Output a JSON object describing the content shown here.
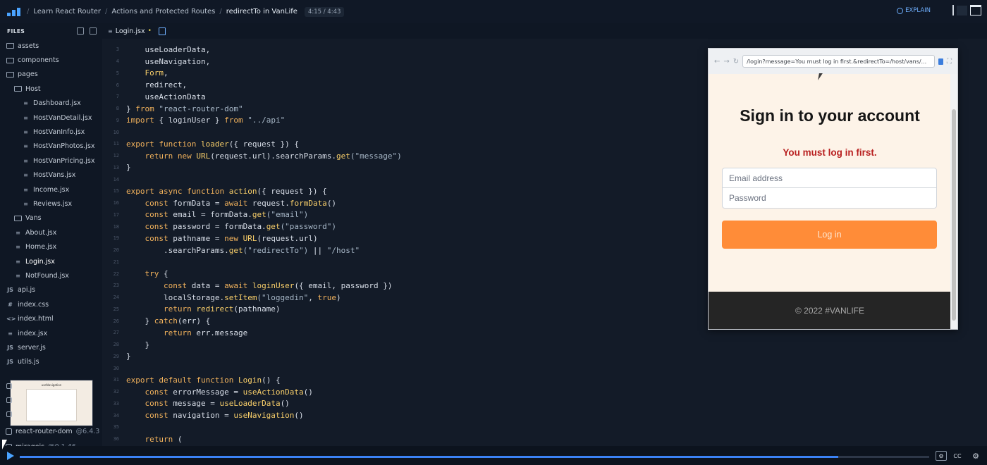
{
  "topbar": {
    "breadcrumbs": [
      "Learn React Router",
      "Actions and Protected Routes",
      "redirectTo in VanLife"
    ],
    "time": "4:15 / 4:43",
    "explain_label": "EXPLAIN"
  },
  "sidebar": {
    "header": "FILES",
    "items": [
      {
        "label": "assets",
        "type": "folder",
        "level": 0
      },
      {
        "label": "components",
        "type": "folder",
        "level": 0
      },
      {
        "label": "pages",
        "type": "folder",
        "level": 0
      },
      {
        "label": "Host",
        "type": "folder",
        "level": 1
      },
      {
        "label": "Dashboard.jsx",
        "type": "jsx",
        "level": 2
      },
      {
        "label": "HostVanDetail.jsx",
        "type": "jsx",
        "level": 2
      },
      {
        "label": "HostVanInfo.jsx",
        "type": "jsx",
        "level": 2
      },
      {
        "label": "HostVanPhotos.jsx",
        "type": "jsx",
        "level": 2
      },
      {
        "label": "HostVanPricing.jsx",
        "type": "jsx",
        "level": 2
      },
      {
        "label": "HostVans.jsx",
        "type": "jsx",
        "level": 2
      },
      {
        "label": "Income.jsx",
        "type": "jsx",
        "level": 2
      },
      {
        "label": "Reviews.jsx",
        "type": "jsx",
        "level": 2
      },
      {
        "label": "Vans",
        "type": "folder",
        "level": 1
      },
      {
        "label": "About.jsx",
        "type": "jsx",
        "level": 1
      },
      {
        "label": "Home.jsx",
        "type": "jsx",
        "level": 1
      },
      {
        "label": "Login.jsx",
        "type": "jsx",
        "level": 1,
        "current": true
      },
      {
        "label": "NotFound.jsx",
        "type": "jsx",
        "level": 1
      },
      {
        "label": "api.js",
        "type": "js",
        "level": 0
      },
      {
        "label": "index.css",
        "type": "css",
        "level": 0
      },
      {
        "label": "index.html",
        "type": "html",
        "level": 0
      },
      {
        "label": "index.jsx",
        "type": "jsx",
        "level": 0
      },
      {
        "label": "server.js",
        "type": "js",
        "level": 0
      },
      {
        "label": "utils.js",
        "type": "js",
        "level": 0
      }
    ],
    "thumbnail_title": "useNavigation",
    "packages": [
      {
        "name": "react-router-dom",
        "version": "@6.4.3"
      },
      {
        "name": "miragejs",
        "version": "@0.1.46"
      }
    ]
  },
  "editor": {
    "tab_label": "Login.jsx",
    "tab_modified": "•",
    "lines": [
      {
        "n": "3",
        "tokens": [
          [
            "plain",
            "    useLoaderData,"
          ]
        ]
      },
      {
        "n": "4",
        "tokens": [
          [
            "plain",
            "    useNavigation,"
          ]
        ]
      },
      {
        "n": "5",
        "tokens": [
          [
            "fn",
            "    Form"
          ],
          [
            "plain",
            ","
          ]
        ]
      },
      {
        "n": "6",
        "tokens": [
          [
            "plain",
            "    redirect,"
          ]
        ]
      },
      {
        "n": "7",
        "tokens": [
          [
            "plain",
            "    useActionData"
          ]
        ]
      },
      {
        "n": "8",
        "tokens": [
          [
            "plain",
            "} "
          ],
          [
            "kw",
            "from"
          ],
          [
            "str",
            " \"react-router-dom\""
          ]
        ]
      },
      {
        "n": "9",
        "tokens": [
          [
            "kw",
            "import"
          ],
          [
            "plain",
            " { loginUser } "
          ],
          [
            "kw",
            "from"
          ],
          [
            "str",
            " \"../api\""
          ]
        ]
      },
      {
        "n": "10",
        "tokens": [
          [
            "plain",
            ""
          ]
        ]
      },
      {
        "n": "11",
        "tokens": [
          [
            "kw",
            "export function"
          ],
          [
            "fn",
            " loader"
          ],
          [
            "plain",
            "({ request }) {"
          ]
        ]
      },
      {
        "n": "12",
        "tokens": [
          [
            "kw",
            "    return new"
          ],
          [
            "fn",
            " URL"
          ],
          [
            "plain",
            "(request.url).searchParams."
          ],
          [
            "fn",
            "get"
          ],
          [
            "str",
            "(\"message\")"
          ]
        ]
      },
      {
        "n": "13",
        "tokens": [
          [
            "plain",
            "}"
          ]
        ]
      },
      {
        "n": "14",
        "tokens": [
          [
            "plain",
            ""
          ]
        ]
      },
      {
        "n": "15",
        "tokens": [
          [
            "kw",
            "export async function"
          ],
          [
            "fn",
            " action"
          ],
          [
            "plain",
            "({ request }) {"
          ]
        ]
      },
      {
        "n": "16",
        "tokens": [
          [
            "kw",
            "    const"
          ],
          [
            "plain",
            " formData = "
          ],
          [
            "kw",
            "await"
          ],
          [
            "plain",
            " request."
          ],
          [
            "fn",
            "formData"
          ],
          [
            "plain",
            "()"
          ]
        ]
      },
      {
        "n": "17",
        "tokens": [
          [
            "kw",
            "    const"
          ],
          [
            "plain",
            " email = formData."
          ],
          [
            "fn",
            "get"
          ],
          [
            "str",
            "(\"email\")"
          ]
        ]
      },
      {
        "n": "18",
        "tokens": [
          [
            "kw",
            "    const"
          ],
          [
            "plain",
            " password = formData."
          ],
          [
            "fn",
            "get"
          ],
          [
            "str",
            "(\"password\")"
          ]
        ]
      },
      {
        "n": "19",
        "tokens": [
          [
            "kw",
            "    const"
          ],
          [
            "plain",
            " pathname = "
          ],
          [
            "kw",
            "new"
          ],
          [
            "fn",
            " URL"
          ],
          [
            "plain",
            "(request.url)"
          ]
        ]
      },
      {
        "n": "20",
        "tokens": [
          [
            "plain",
            "        .searchParams."
          ],
          [
            "fn",
            "get"
          ],
          [
            "str",
            "(\"redirectTo\")"
          ],
          [
            "plain",
            " || "
          ],
          [
            "str",
            "\"/host\""
          ]
        ]
      },
      {
        "n": "21",
        "tokens": [
          [
            "plain",
            ""
          ]
        ]
      },
      {
        "n": "22",
        "tokens": [
          [
            "kw",
            "    try"
          ],
          [
            "plain",
            " {"
          ]
        ]
      },
      {
        "n": "23",
        "tokens": [
          [
            "kw",
            "        const"
          ],
          [
            "plain",
            " data = "
          ],
          [
            "kw",
            "await"
          ],
          [
            "fn",
            " loginUser"
          ],
          [
            "plain",
            "({ email, password })"
          ]
        ]
      },
      {
        "n": "24",
        "tokens": [
          [
            "plain",
            "        localStorage."
          ],
          [
            "fn",
            "setItem"
          ],
          [
            "str",
            "(\"loggedin\""
          ],
          [
            "plain",
            ", "
          ],
          [
            "kw",
            "true"
          ],
          [
            "plain",
            ")"
          ]
        ]
      },
      {
        "n": "25",
        "tokens": [
          [
            "kw",
            "        return"
          ],
          [
            "fn",
            " redirect"
          ],
          [
            "plain",
            "(pathname)"
          ]
        ]
      },
      {
        "n": "26",
        "tokens": [
          [
            "plain",
            "    } "
          ],
          [
            "kw",
            "catch"
          ],
          [
            "plain",
            "(err) {"
          ]
        ]
      },
      {
        "n": "27",
        "tokens": [
          [
            "kw",
            "        return"
          ],
          [
            "plain",
            " err.message"
          ]
        ]
      },
      {
        "n": "28",
        "tokens": [
          [
            "plain",
            "    }"
          ]
        ]
      },
      {
        "n": "29",
        "tokens": [
          [
            "plain",
            "}"
          ]
        ]
      },
      {
        "n": "30",
        "tokens": [
          [
            "plain",
            ""
          ]
        ]
      },
      {
        "n": "31",
        "tokens": [
          [
            "kw",
            "export default function"
          ],
          [
            "fn",
            " Login"
          ],
          [
            "plain",
            "() {"
          ]
        ]
      },
      {
        "n": "32",
        "tokens": [
          [
            "kw",
            "    const"
          ],
          [
            "plain",
            " errorMessage = "
          ],
          [
            "fn",
            "useActionData"
          ],
          [
            "plain",
            "()"
          ]
        ]
      },
      {
        "n": "33",
        "tokens": [
          [
            "kw",
            "    const"
          ],
          [
            "plain",
            " message = "
          ],
          [
            "fn",
            "useLoaderData"
          ],
          [
            "plain",
            "()"
          ]
        ]
      },
      {
        "n": "34",
        "tokens": [
          [
            "kw",
            "    const"
          ],
          [
            "plain",
            " navigation = "
          ],
          [
            "fn",
            "useNavigation"
          ],
          [
            "plain",
            "()"
          ]
        ]
      },
      {
        "n": "35",
        "tokens": [
          [
            "plain",
            ""
          ]
        ]
      },
      {
        "n": "36",
        "tokens": [
          [
            "kw",
            "    return"
          ],
          [
            "plain",
            " ("
          ]
        ]
      }
    ]
  },
  "preview": {
    "url": "/login?message=You must log in first.&redirectTo=/host/vans/...",
    "heading": "Sign in to your account",
    "error": "You must log in first.",
    "email_placeholder": "Email address",
    "password_placeholder": "Password",
    "login_label": "Log in",
    "footer": "© 2022 #VANLIFE"
  },
  "player": {
    "progress": 0.9,
    "cc_label": "CC"
  }
}
